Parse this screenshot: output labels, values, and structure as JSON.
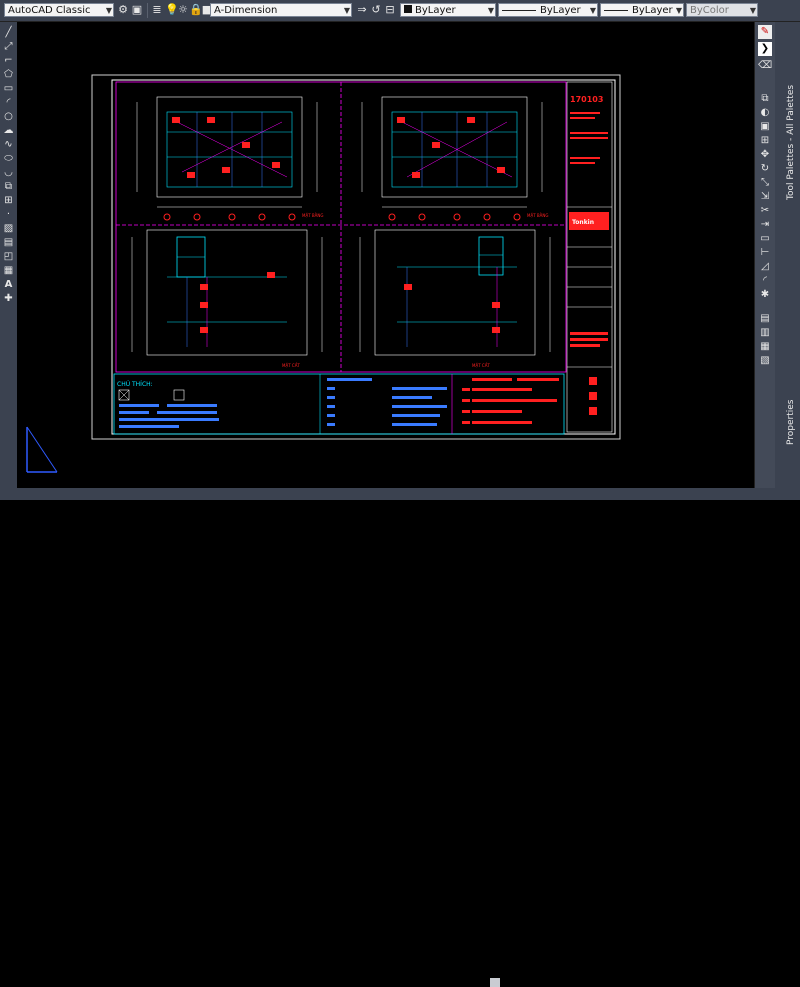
{
  "toolbar": {
    "workspace": "AutoCAD Classic",
    "layer": "A-Dimension",
    "color": "ByLayer",
    "linetype": "ByLayer",
    "lineweight": "ByLayer",
    "plotstyle": "ByColor"
  },
  "palettes": {
    "tool_palettes": "Tool Palettes - All Palettes",
    "properties": "Properties"
  },
  "drawing": {
    "title_code": "170103",
    "legend_title": "CHÚ THÍCH:",
    "logo_text": "Tonkin",
    "section_labels": [
      "MẶT BẰNG",
      "MẶT BẰNG",
      "MẶT CẮT",
      "MẶT CẮT"
    ]
  },
  "colors": {
    "accent_red": "#ff2020",
    "cyan": "#00e5ff",
    "magenta": "#ff00ff",
    "blue": "#3a7bff",
    "white": "#ffffff"
  }
}
